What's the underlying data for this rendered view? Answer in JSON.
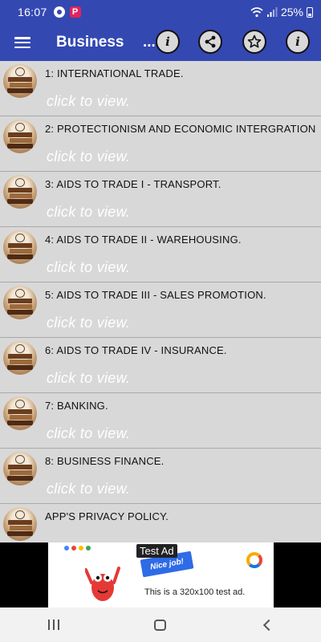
{
  "status_bar": {
    "time": "16:07",
    "battery": "25%",
    "notification_icons": [
      "messenger-icon",
      "p-app-icon"
    ],
    "p_icon_letter": "P"
  },
  "app_bar": {
    "title": "Business",
    "title_ellipsis": "...",
    "actions": [
      "info-icon",
      "share-icon",
      "star-icon",
      "info-icon"
    ]
  },
  "list": {
    "items": [
      {
        "title": "1: INTERNATIONAL TRADE.",
        "subtitle": "click to view."
      },
      {
        "title": "2: PROTECTIONISM AND ECONOMIC INTERGRATION",
        "subtitle": "click to view."
      },
      {
        "title": "3: AIDS TO TRADE I - TRANSPORT.",
        "subtitle": "click to view."
      },
      {
        "title": "4: AIDS TO TRADE II - WAREHOUSING.",
        "subtitle": "click to view."
      },
      {
        "title": "5: AIDS TO TRADE III - SALES PROMOTION.",
        "subtitle": "click to view."
      },
      {
        "title": "6: AIDS TO TRADE IV - INSURANCE.",
        "subtitle": "click to view."
      },
      {
        "title": "7: BANKING.",
        "subtitle": "click to view."
      },
      {
        "title": "8: BUSINESS FINANCE.",
        "subtitle": "click to view."
      },
      {
        "title": "APP'S PRIVACY POLICY.",
        "subtitle": ""
      }
    ]
  },
  "ad": {
    "badge": "Test Ad",
    "banner_label": "Nice job!",
    "text": "This is a 320x100 test ad."
  },
  "colors": {
    "primary": "#3448b2",
    "list_background": "#d8d8d8",
    "subtitle": "#ffffff"
  }
}
